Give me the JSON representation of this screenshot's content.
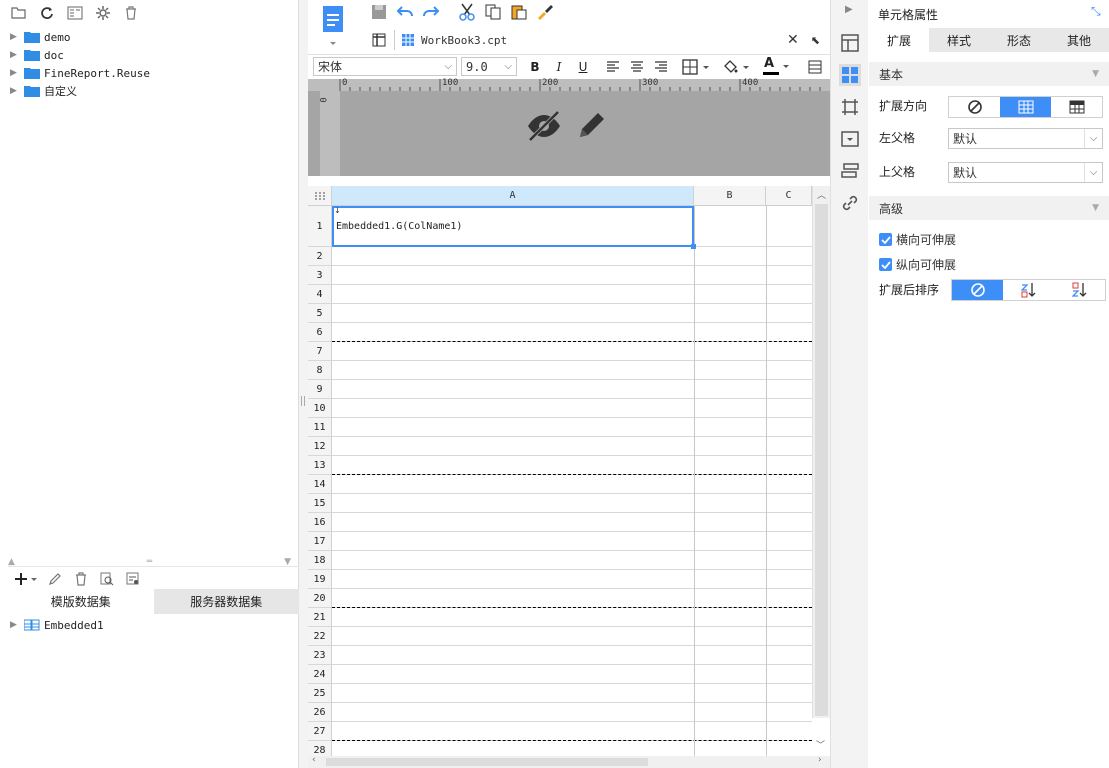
{
  "tree": {
    "items": [
      {
        "label": "demo"
      },
      {
        "label": "doc"
      },
      {
        "label": "FineReport.Reuse"
      },
      {
        "label": "自定义"
      }
    ]
  },
  "datasets": {
    "tabs": [
      {
        "label": "模版数据集",
        "active": true
      },
      {
        "label": "服务器数据集",
        "active": false
      }
    ],
    "items": [
      {
        "label": "Embedded1"
      }
    ]
  },
  "editor": {
    "tab_title": "WorkBook3.cpt",
    "font_name": "宋体",
    "font_size": "9.0",
    "bold_label": "B",
    "italic_label": "I",
    "underline_label": "U",
    "font_color_label": "A",
    "ruler_ticks": [
      "0",
      "100",
      "200",
      "300",
      "400"
    ],
    "vruler_tick": "0"
  },
  "sheet": {
    "columns": [
      "A",
      "B",
      "C"
    ],
    "rows": [
      "1",
      "2",
      "3",
      "4",
      "5",
      "6",
      "7",
      "8",
      "9",
      "10",
      "11",
      "12",
      "13",
      "14",
      "15",
      "16",
      "17",
      "18",
      "19",
      "20",
      "21",
      "22",
      "23",
      "24",
      "25",
      "26",
      "27",
      "28"
    ],
    "cell_a1": "Embedded1.G(ColName1)",
    "page_break_rows": [
      6,
      13,
      20,
      27
    ]
  },
  "properties": {
    "title": "单元格属性",
    "tabs": [
      {
        "label": "扩展",
        "active": true
      },
      {
        "label": "样式",
        "active": false
      },
      {
        "label": "形态",
        "active": false
      },
      {
        "label": "其他",
        "active": false
      }
    ],
    "basic_section": "基本",
    "expand_direction_label": "扩展方向",
    "left_parent_label": "左父格",
    "left_parent_value": "默认",
    "upper_parent_label": "上父格",
    "upper_parent_value": "默认",
    "advanced_section": "高级",
    "horizontal_extendable": "横向可伸展",
    "vertical_extendable": "纵向可伸展",
    "sort_after_expand_label": "扩展后排序"
  },
  "colors": {
    "accent": "#3e8ef7",
    "ruler_bg": "#a5a5a5",
    "panel_bg": "#f3f3f3"
  }
}
